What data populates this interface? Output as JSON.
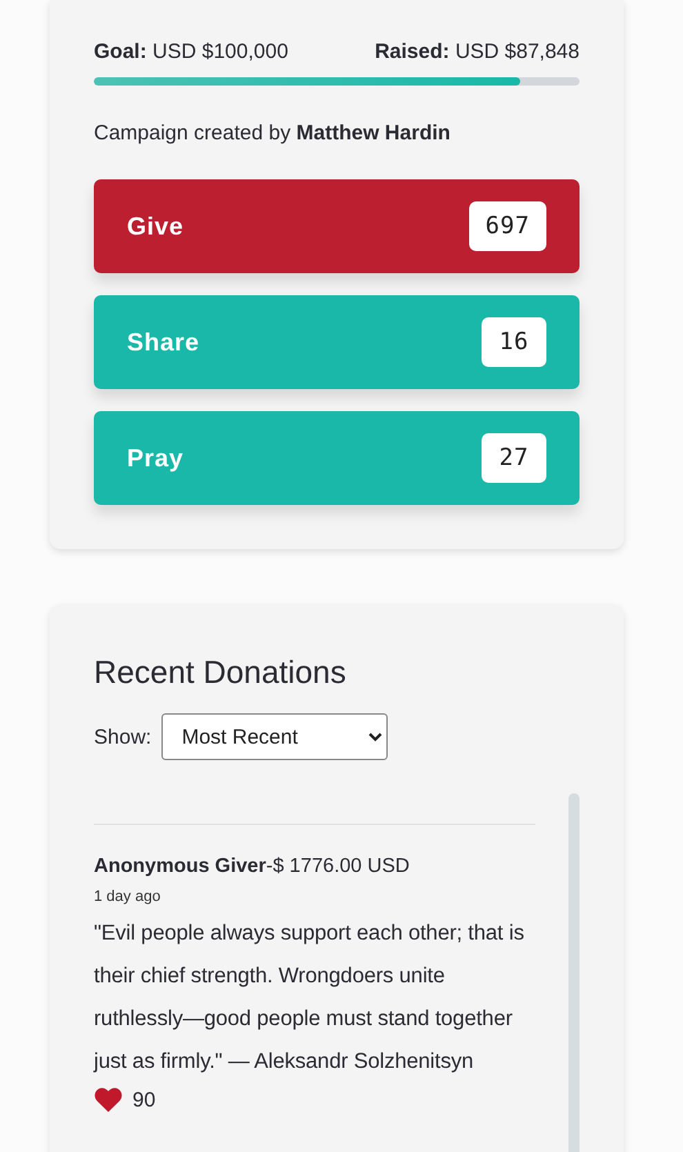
{
  "campaign": {
    "goal_label": "Goal:",
    "goal": "USD $100,000",
    "raised_label": "Raised:",
    "raised": "USD $87,848",
    "level": 0.878,
    "creator_prefix": "Campaign created by",
    "creator": "Matthew Hardin",
    "actions": [
      {
        "label": "Give",
        "count": "697",
        "color": "#bc1f2f"
      },
      {
        "label": "Share",
        "count": "16",
        "color": "#19b8a8"
      },
      {
        "label": "Pray",
        "count": "27",
        "color": "#19b8a8"
      }
    ]
  },
  "donations": {
    "title": "Recent Donations",
    "show_label": "Show:",
    "sort": "Most Recent",
    "items": [
      {
        "donor": "Anonymous Giver",
        "amount": "-$ 1776.00 USD",
        "time": "1 day ago",
        "message": "\"Evil people always support each other; that is their chief strength. Wrongdoers unite ruthlessly—good people must stand together just as firmly.\" — Aleksandr Solzhenitsyn",
        "likes": "90"
      }
    ]
  }
}
